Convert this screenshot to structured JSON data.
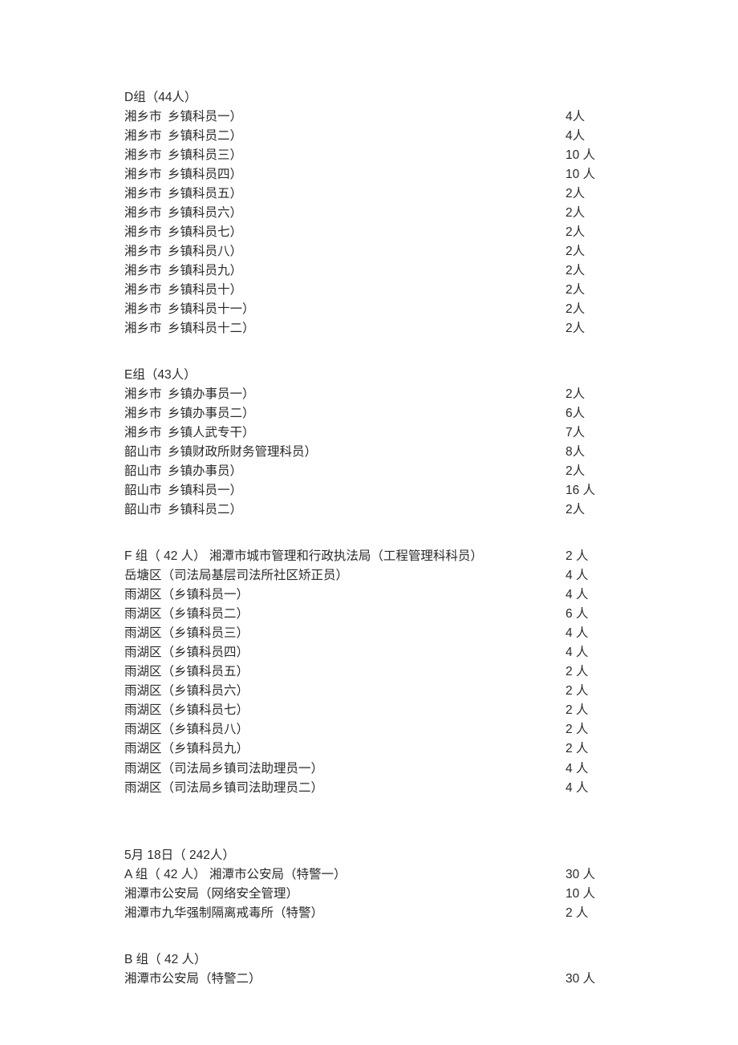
{
  "groups": [
    {
      "header": "D组（44人）",
      "separate_region_column": true,
      "rows": [
        {
          "region": "湘乡市",
          "desc": "乡镇科员一）",
          "count": "4人"
        },
        {
          "region": "湘乡市",
          "desc": "乡镇科员二）",
          "count": "4人"
        },
        {
          "region": "湘乡市",
          "desc": "乡镇科员三）",
          "count": "10 人"
        },
        {
          "region": "湘乡市",
          "desc": "乡镇科员四）",
          "count": "10 人"
        },
        {
          "region": "湘乡市",
          "desc": "乡镇科员五）",
          "count": "2人"
        },
        {
          "region": "湘乡市",
          "desc": "乡镇科员六）",
          "count": "2人"
        },
        {
          "region": "湘乡市",
          "desc": "乡镇科员七）",
          "count": "2人"
        },
        {
          "region": "湘乡市",
          "desc": "乡镇科员八）",
          "count": "2人"
        },
        {
          "region": "湘乡市",
          "desc": "乡镇科员九）",
          "count": "2人"
        },
        {
          "region": "湘乡市",
          "desc": "乡镇科员十）",
          "count": "2人"
        },
        {
          "region": "湘乡市",
          "desc": "乡镇科员十一）",
          "count": "2人"
        },
        {
          "region": "湘乡市",
          "desc": "乡镇科员十二）",
          "count": "2人"
        }
      ]
    },
    {
      "header": "E组（43人）",
      "separate_region_column": true,
      "rows": [
        {
          "region": "湘乡市",
          "desc": "乡镇办事员一）",
          "count": "2人"
        },
        {
          "region": "湘乡市",
          "desc": "乡镇办事员二）",
          "count": "6人"
        },
        {
          "region": "湘乡市",
          "desc": "乡镇人武专干）",
          "count": "7人"
        },
        {
          "region": "韶山市",
          "desc": "乡镇财政所财务管理科员）",
          "count": "8人"
        },
        {
          "region": "韶山市",
          "desc": "乡镇办事员）",
          "count": "2人"
        },
        {
          "region": "韶山市",
          "desc": "乡镇科员一）",
          "count": "16 人"
        },
        {
          "region": "韶山市",
          "desc": "乡镇科员二）",
          "count": "2人"
        }
      ]
    },
    {
      "header_inline": {
        "desc": "F 组（ 42 人）  湘潭市城市管理和行政执法局（工程管理科科员）",
        "count": "2 人"
      },
      "separate_region_column": false,
      "rows": [
        {
          "desc": "岳塘区（司法局基层司法所社区矫正员）",
          "count": "4 人"
        },
        {
          "desc": "雨湖区（乡镇科员一）",
          "count": "4 人"
        },
        {
          "desc": "雨湖区（乡镇科员二）",
          "count": "6 人"
        },
        {
          "desc": "雨湖区（乡镇科员三）",
          "count": "4 人"
        },
        {
          "desc": "雨湖区（乡镇科员四）",
          "count": "4 人"
        },
        {
          "desc": "雨湖区（乡镇科员五）",
          "count": "2 人"
        },
        {
          "desc": "雨湖区（乡镇科员六）",
          "count": "2 人"
        },
        {
          "desc": "雨湖区（乡镇科员七）",
          "count": "2 人"
        },
        {
          "desc": "雨湖区（乡镇科员八）",
          "count": "2 人"
        },
        {
          "desc": "雨湖区（乡镇科员九）",
          "count": "2 人"
        },
        {
          "desc": "雨湖区（司法局乡镇司法助理员一）",
          "count": "4 人"
        },
        {
          "desc": "雨湖区（司法局乡镇司法助理员二）",
          "count": "4 人"
        }
      ]
    },
    {
      "pre_header": "5月  18日（ 242人）",
      "header_inline": {
        "desc": "A 组（ 42 人）  湘潭市公安局（特警一）",
        "count": "30 人"
      },
      "separate_region_column": false,
      "rows": [
        {
          "desc": "湘潭市公安局（网络安全管理）",
          "count": "10 人"
        },
        {
          "desc": "湘潭市九华强制隔离戒毒所（特警）",
          "count": "2 人"
        }
      ]
    },
    {
      "header": "B 组（ 42 人）",
      "separate_region_column": false,
      "rows": [
        {
          "desc": "湘潭市公安局（特警二）",
          "count": "30 人"
        }
      ]
    }
  ]
}
